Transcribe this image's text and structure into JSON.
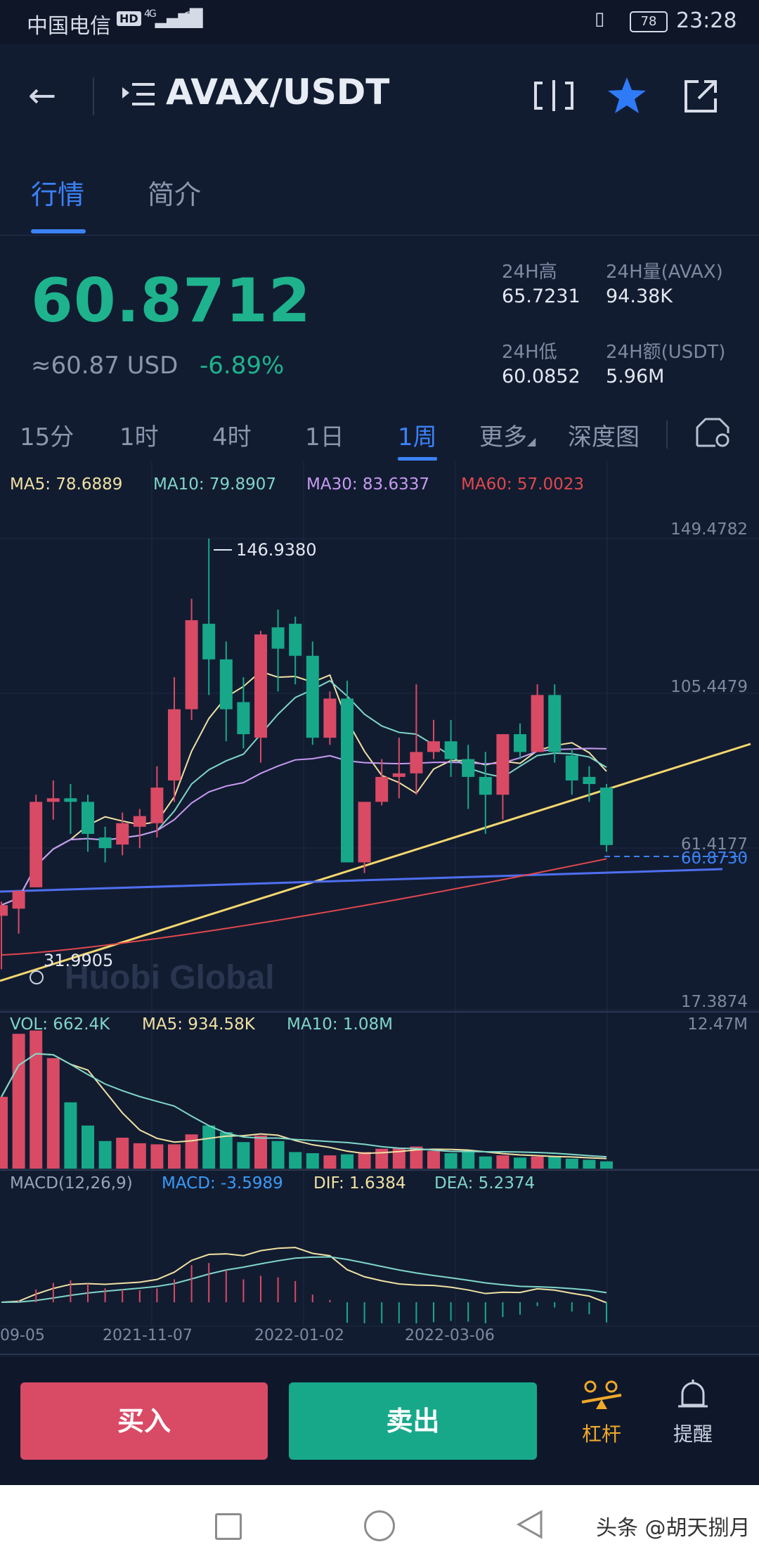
{
  "status_bar": {
    "carrier": "中国电信",
    "hd": "HD",
    "network": "4G",
    "battery": "78",
    "time": "23:28"
  },
  "header": {
    "pair": "AVAX/USDT"
  },
  "tabs": [
    {
      "label": "行情",
      "active": true
    },
    {
      "label": "简介",
      "active": false
    }
  ],
  "ticker": {
    "price": "60.8712",
    "usd": "≈60.87 USD",
    "change": "-6.89%",
    "high_label": "24H高",
    "high": "65.7231",
    "vol_label": "24H量(AVAX)",
    "vol": "94.38K",
    "low_label": "24H低",
    "low": "60.0852",
    "amount_label": "24H额(USDT)",
    "amount": "5.96M"
  },
  "intervals": [
    {
      "label": "15分"
    },
    {
      "label": "1时"
    },
    {
      "label": "4时"
    },
    {
      "label": "1日"
    },
    {
      "label": "1周",
      "active": true
    },
    {
      "label": "更多"
    },
    {
      "label": "深度图"
    }
  ],
  "chart": {
    "ma_legend": {
      "ma5": "MA5: 78.6889",
      "ma10": "MA10: 79.8907",
      "ma30": "MA30: 83.6337",
      "ma60": "MA60: 57.0023"
    },
    "y_labels": {
      "top": "149.4782",
      "mid": "105.4479",
      "low": "61.4177",
      "bottom": "17.3874"
    },
    "high_marker": "146.9380",
    "low_marker": "31.9905",
    "last_price": "60.8730",
    "watermark": "Huobi Global",
    "vol_legend": {
      "vol": "VOL: 662.4K",
      "ma5": "MA5: 934.58K",
      "ma10": "MA10: 1.08M",
      "max": "12.47M"
    },
    "macd_legend": {
      "name": "MACD(12,26,9)",
      "macd": "MACD: -3.5989",
      "dif": "DIF: 1.6384",
      "dea": "DEA: 5.2374"
    },
    "dates": [
      "09-05",
      "2021-11-07",
      "2022-01-02",
      "2022-03-06"
    ],
    "colors": {
      "up": "#d94a65",
      "down": "#17a88a",
      "ma5": "#f0e1a2",
      "ma10": "#7fd6c8",
      "ma30": "#c79bf0",
      "ma60": "#e0484c",
      "accent": "#3b82f6"
    }
  },
  "chart_data": {
    "type": "candlestick",
    "interval": "1周",
    "ylim": [
      17.3874,
      149.4782
    ],
    "candles": [
      {
        "o": 41,
        "h": 45,
        "l": 26,
        "c": 44
      },
      {
        "o": 43,
        "h": 48,
        "l": 36,
        "c": 48
      },
      {
        "o": 49,
        "h": 75,
        "l": 49,
        "c": 73
      },
      {
        "o": 73,
        "h": 79,
        "l": 68,
        "c": 74
      },
      {
        "o": 74,
        "h": 78,
        "l": 64,
        "c": 73
      },
      {
        "o": 73,
        "h": 75,
        "l": 59,
        "c": 64
      },
      {
        "o": 63,
        "h": 66,
        "l": 56,
        "c": 60
      },
      {
        "o": 61,
        "h": 70,
        "l": 58,
        "c": 67
      },
      {
        "o": 66,
        "h": 71,
        "l": 60,
        "c": 69
      },
      {
        "o": 67,
        "h": 83,
        "l": 63,
        "c": 77
      },
      {
        "o": 79,
        "h": 108,
        "l": 73,
        "c": 99
      },
      {
        "o": 99,
        "h": 130,
        "l": 96,
        "c": 124
      },
      {
        "o": 123,
        "h": 146.938,
        "l": 103,
        "c": 113
      },
      {
        "o": 113,
        "h": 118,
        "l": 90,
        "c": 99
      },
      {
        "o": 101,
        "h": 108,
        "l": 88,
        "c": 92
      },
      {
        "o": 91,
        "h": 121,
        "l": 84,
        "c": 120
      },
      {
        "o": 122,
        "h": 127,
        "l": 104,
        "c": 116
      },
      {
        "o": 123,
        "h": 125,
        "l": 106,
        "c": 114
      },
      {
        "o": 114,
        "h": 118,
        "l": 89,
        "c": 91
      },
      {
        "o": 91,
        "h": 104,
        "l": 89,
        "c": 102
      },
      {
        "o": 102,
        "h": 107,
        "l": 74,
        "c": 56
      },
      {
        "o": 56,
        "h": 72,
        "l": 53,
        "c": 73
      },
      {
        "o": 73,
        "h": 85,
        "l": 72,
        "c": 80
      },
      {
        "o": 80,
        "h": 91,
        "l": 74,
        "c": 81
      },
      {
        "o": 81,
        "h": 106,
        "l": 75,
        "c": 87
      },
      {
        "o": 87,
        "h": 96,
        "l": 85,
        "c": 90
      },
      {
        "o": 90,
        "h": 96,
        "l": 80,
        "c": 85
      },
      {
        "o": 85,
        "h": 89,
        "l": 71,
        "c": 80
      },
      {
        "o": 80,
        "h": 87,
        "l": 64,
        "c": 75
      },
      {
        "o": 75,
        "h": 92,
        "l": 68,
        "c": 92
      },
      {
        "o": 92,
        "h": 95,
        "l": 85,
        "c": 87
      },
      {
        "o": 87,
        "h": 106,
        "l": 87,
        "c": 103
      },
      {
        "o": 103,
        "h": 106,
        "l": 84,
        "c": 87
      },
      {
        "o": 86,
        "h": 88,
        "l": 75,
        "c": 79
      },
      {
        "o": 80,
        "h": 83,
        "l": 73,
        "c": 78
      },
      {
        "o": 77,
        "h": 78,
        "l": 59,
        "c": 60.873
      }
    ],
    "volume": [
      6.5,
      12.2,
      12.5,
      10.0,
      6.0,
      3.9,
      2.5,
      2.8,
      2.3,
      2.2,
      2.2,
      3.1,
      3.9,
      3.3,
      2.4,
      3.0,
      2.5,
      1.5,
      1.4,
      1.2,
      1.3,
      1.5,
      1.8,
      1.9,
      2.0,
      1.6,
      1.4,
      1.5,
      1.1,
      1.2,
      1.0,
      1.1,
      1.1,
      0.9,
      0.8,
      0.66
    ]
  }
}
